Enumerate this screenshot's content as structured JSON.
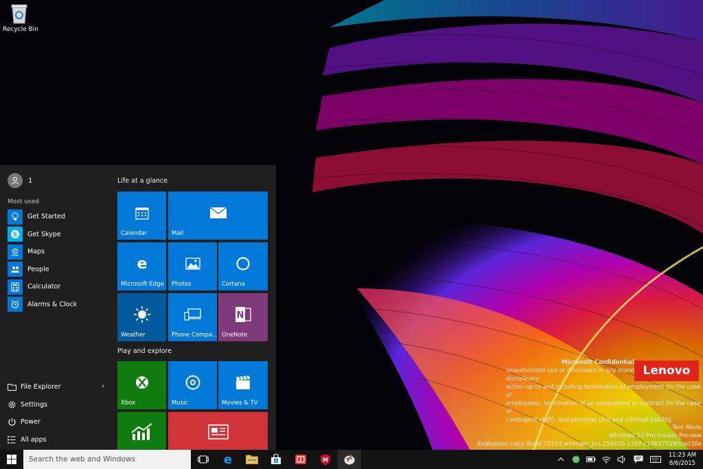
{
  "desktop": {
    "recycle_bin_label": "Recycle Bin"
  },
  "start_menu": {
    "user_name": "1",
    "most_used_label": "Most used",
    "most_used": [
      {
        "label": "Get Started",
        "icon": "lightbulb-icon"
      },
      {
        "label": "Get Skype",
        "icon": "skype-icon"
      },
      {
        "label": "Maps",
        "icon": "maps-icon"
      },
      {
        "label": "People",
        "icon": "people-icon"
      },
      {
        "label": "Calculator",
        "icon": "calculator-icon"
      },
      {
        "label": "Alarms & Clock",
        "icon": "alarm-clock-icon"
      }
    ],
    "bottom": {
      "file_explorer": "File Explorer",
      "settings": "Settings",
      "power": "Power",
      "all_apps": "All apps"
    },
    "groups": {
      "life_title": "Life at a glance",
      "play_title": "Play and explore"
    },
    "tiles": {
      "calendar": "Calendar",
      "mail": "Mail",
      "edge": "Microsoft Edge",
      "photos": "Photos",
      "cortana": "Cortana",
      "weather": "Weather",
      "phone": "Phone Compa...",
      "onenote": "OneNote",
      "xbox": "Xbox",
      "music": "Music",
      "movies": "Movies & TV"
    }
  },
  "watermark": {
    "confidential_title": "Microsoft Confidential",
    "confidential_lines": [
      "Unauthorized use or disclosure in any manner may result in disciplinary",
      "action up to and including termination of employment (in the case of",
      "employees), termination of an assignment or contract (in the case of",
      "contingent staff), and potential civil and criminal liability."
    ],
    "brand": "Lenovo",
    "test_mode": "Test Mode",
    "edition": "Windows 10 Pro Insider Preview",
    "build": "Evaluation copy. Build 10163.winmain_prs.150630-1700.c106270290ced30e"
  },
  "taskbar": {
    "search_placeholder": "Search the web and Windows",
    "time": "11:23 AM",
    "date": "8/6/2015"
  },
  "colors": {
    "accent": "#0078d7",
    "weather": "#005a9e",
    "onenote": "#80397b",
    "xbox": "#107c10",
    "news": "#d13438",
    "lenovo": "#e2231a"
  }
}
